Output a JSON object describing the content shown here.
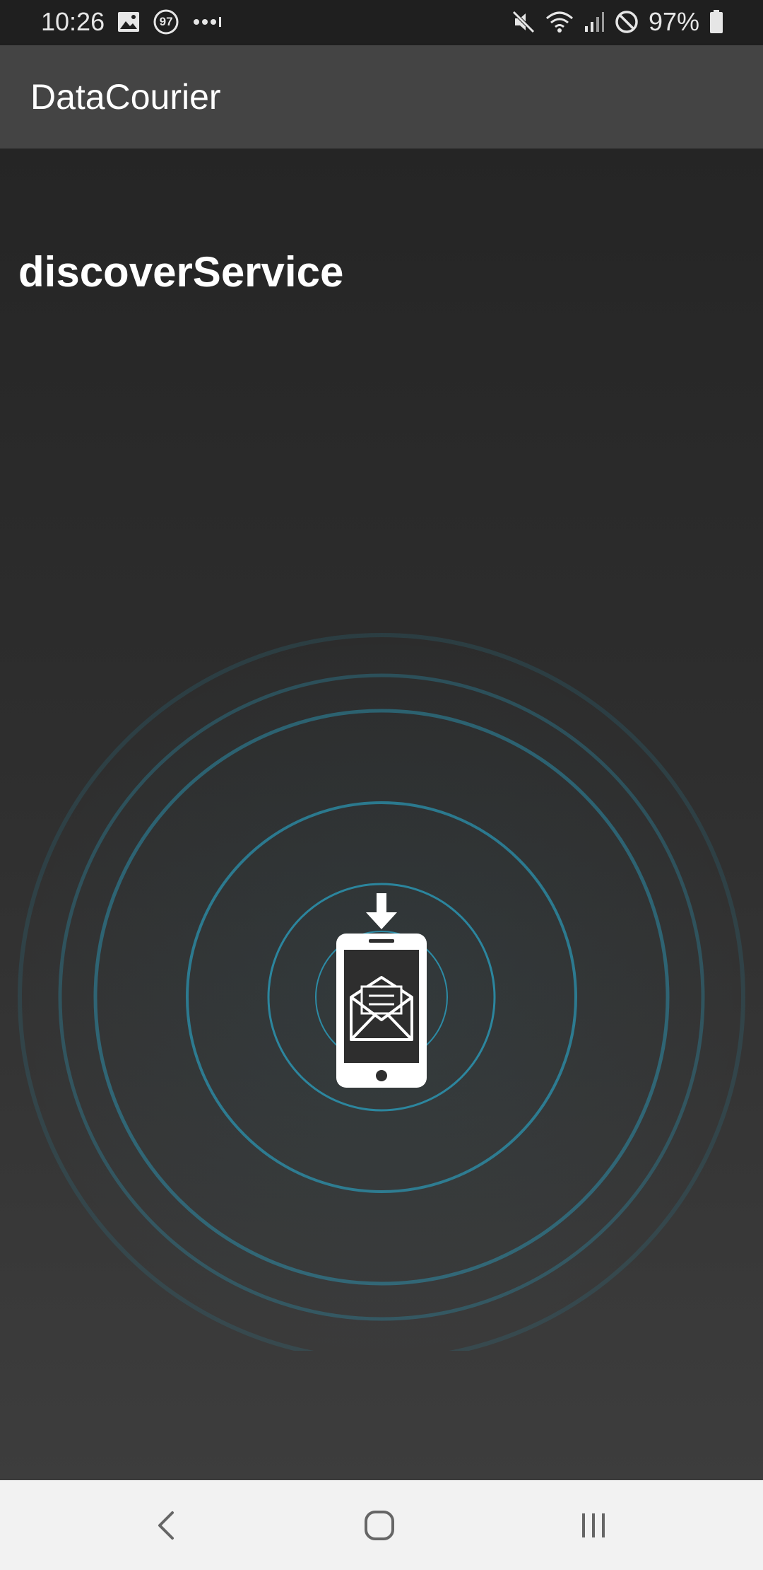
{
  "status_bar": {
    "time": "10:26",
    "notification_badge": "97",
    "battery": "97%",
    "icons": [
      "image-icon",
      "notification-count-icon",
      "more-dots-icon",
      "mute-icon",
      "wifi-icon",
      "signal-icon",
      "do-not-disturb-icon",
      "battery-icon"
    ]
  },
  "app_bar": {
    "title": "DataCourier"
  },
  "main": {
    "heading": "discoverService",
    "illustration": "phone-receiving-message-icon"
  },
  "nav_bar": {
    "buttons": [
      "back-icon",
      "home-icon",
      "recents-icon"
    ]
  },
  "colors": {
    "status_bar_bg": "#1f1f1f",
    "app_bar_bg": "#444444",
    "content_bg_top": "#252525",
    "content_bg_bottom": "#3d3d3d",
    "ring_color": "#2aa0c0",
    "nav_bar_bg": "#f2f2f2"
  }
}
